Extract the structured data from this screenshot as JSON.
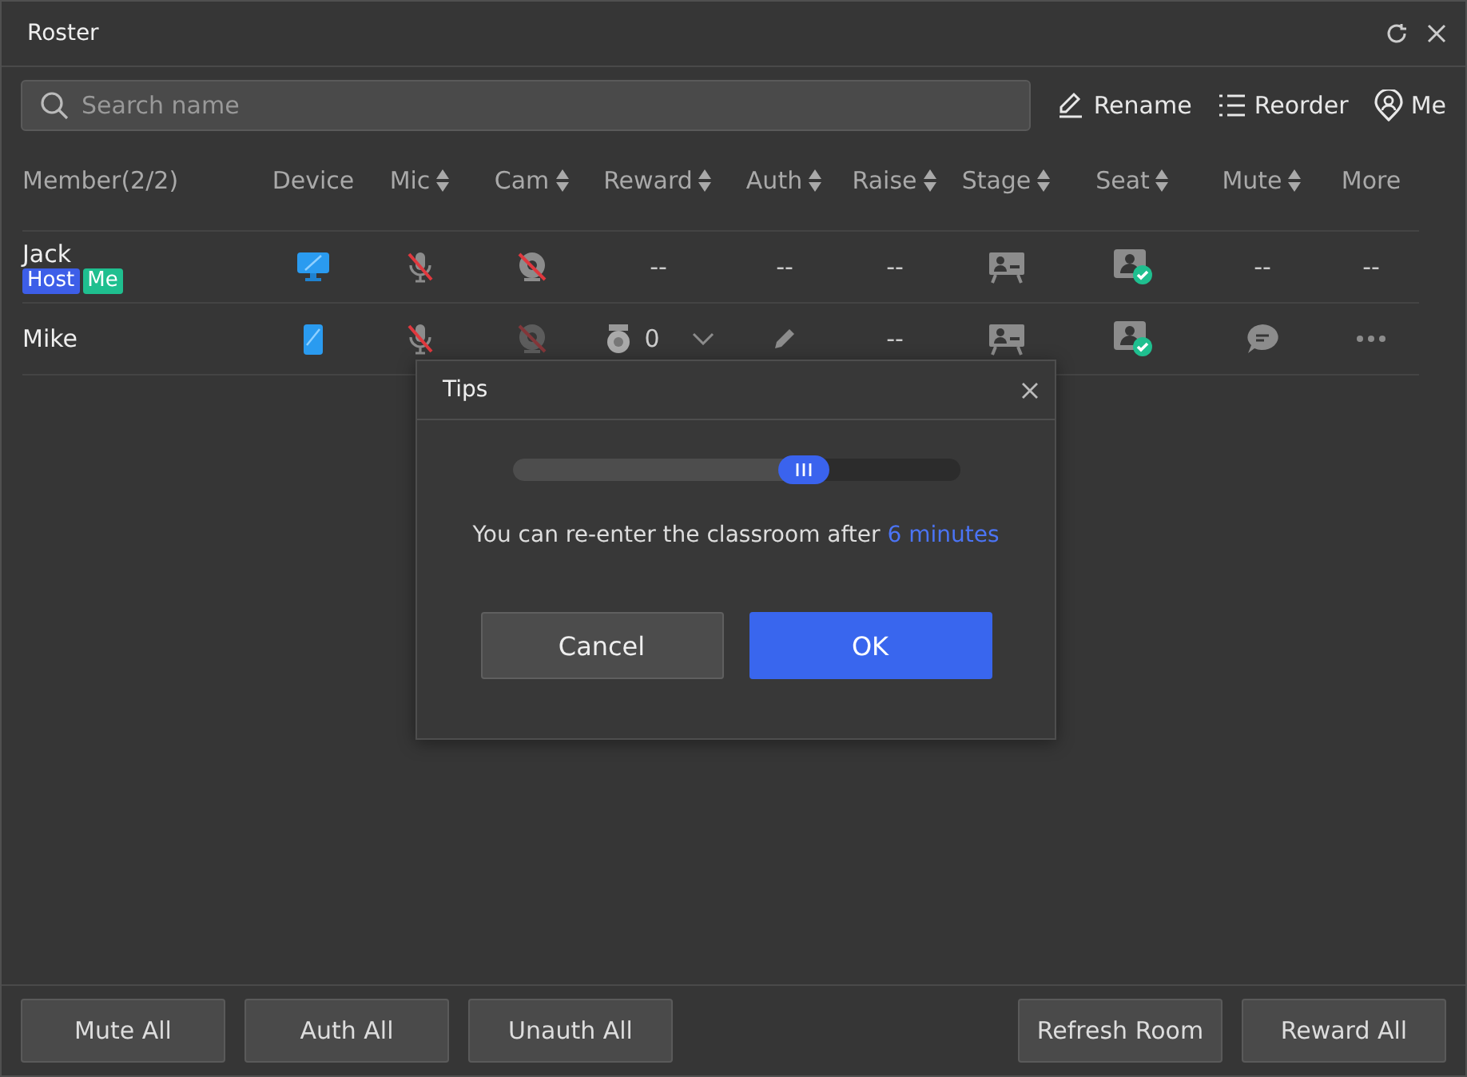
{
  "window": {
    "title": "Roster"
  },
  "search": {
    "placeholder": "Search name"
  },
  "toolbar": [
    {
      "kind": "rename",
      "label": "Rename"
    },
    {
      "kind": "reorder",
      "label": "Reorder"
    },
    {
      "kind": "me",
      "label": "Me"
    }
  ],
  "table": {
    "columns": [
      {
        "label": "Member(2/2)",
        "sortable": false
      },
      {
        "label": "Device",
        "sortable": false
      },
      {
        "label": "Mic",
        "sortable": true
      },
      {
        "label": "Cam",
        "sortable": true
      },
      {
        "label": "Reward",
        "sortable": true
      },
      {
        "label": "Auth",
        "sortable": true
      },
      {
        "label": "Raise",
        "sortable": true
      },
      {
        "label": "Stage",
        "sortable": true
      },
      {
        "label": "Seat",
        "sortable": true
      },
      {
        "label": "Mute",
        "sortable": true
      },
      {
        "label": "More",
        "sortable": false
      }
    ],
    "rows": [
      {
        "cells": [
          {
            "kind": "member",
            "name": "Jack",
            "tags": [
              {
                "label": "Host",
                "color": "#3d5ee8"
              },
              {
                "label": "Me",
                "color": "#1fbf8f"
              }
            ]
          },
          {
            "kind": "desktop"
          },
          {
            "kind": "mic-off",
            "disabled": false
          },
          {
            "kind": "cam-off",
            "disabled": false
          },
          {
            "kind": "text",
            "text": "--"
          },
          {
            "kind": "text",
            "text": "--"
          },
          {
            "kind": "text",
            "text": "--"
          },
          {
            "kind": "stage"
          },
          {
            "kind": "seat"
          },
          {
            "kind": "text",
            "text": "--"
          },
          {
            "kind": "text",
            "text": "--"
          }
        ]
      },
      {
        "cells": [
          {
            "kind": "member",
            "name": "Mike"
          },
          {
            "kind": "mobile"
          },
          {
            "kind": "mic-off",
            "disabled": false
          },
          {
            "kind": "cam-off",
            "disabled": true
          },
          {
            "kind": "reward",
            "text": "0"
          },
          {
            "kind": "auth"
          },
          {
            "kind": "text",
            "text": "--"
          },
          {
            "kind": "stage"
          },
          {
            "kind": "seat"
          },
          {
            "kind": "chat"
          },
          {
            "kind": "more"
          }
        ]
      }
    ]
  },
  "dialog": {
    "title": "Tips",
    "level": 0.65,
    "message": "You can re-enter the classroom after",
    "highlight": "6 minutes",
    "buttons": [
      {
        "label": "Cancel",
        "primary": false
      },
      {
        "label": "OK",
        "primary": true
      }
    ]
  },
  "footer": {
    "left": [
      "Mute All",
      "Auth All",
      "Unauth All"
    ],
    "right": [
      "Refresh Room",
      "Reward All"
    ]
  }
}
